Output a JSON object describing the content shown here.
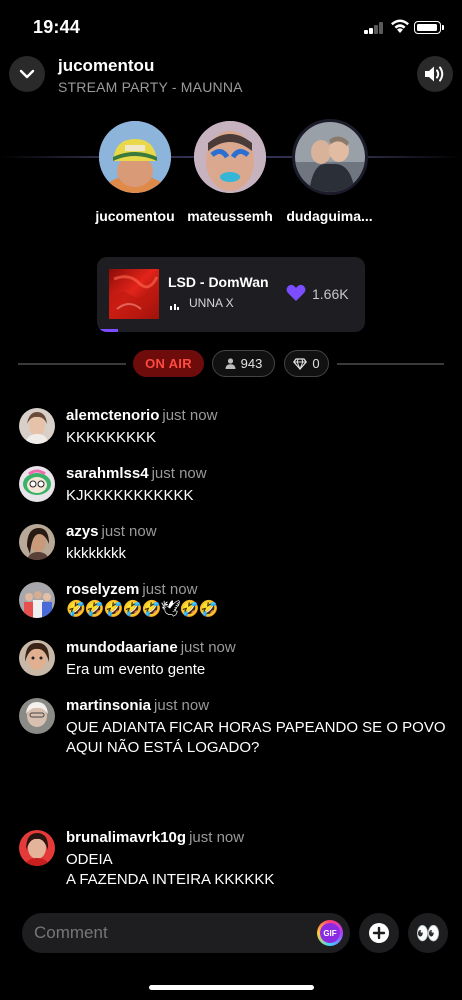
{
  "status_bar": {
    "time": "19:44",
    "signal_bars": 2,
    "battery_level": 0.8
  },
  "header": {
    "title": "jucomentou",
    "subtitle": "STREAM PARTY - MAUNNA",
    "collapse_icon": "chevron-down-icon",
    "volume_icon": "speaker-icon"
  },
  "participants": [
    {
      "name": "jucomentou"
    },
    {
      "name": "mateussemh"
    },
    {
      "name": "dudaguima..."
    }
  ],
  "now_playing": {
    "title": "LSD - DomWan",
    "artist": "UNNA X",
    "likes": "1.66K",
    "progress": 0.08,
    "accent": "#7b4dff"
  },
  "live": {
    "on_air_label": "ON AIR",
    "viewers": "943",
    "gems": "0",
    "on_air_color": "#ff4a40"
  },
  "chat": [
    {
      "user": "alemctenorio",
      "time": "just now",
      "text": "KKKKKKKKK"
    },
    {
      "user": "sarahmlss4",
      "time": "just now",
      "text": "KJKKKKKKKKKKK"
    },
    {
      "user": "azys",
      "time": "just now",
      "text": "kkkkkkkk"
    },
    {
      "user": "roselyzem",
      "time": "just now",
      "text": "🤣🤣🤣🤣🤣🕊🤣🤣"
    },
    {
      "user": "mundodaariane",
      "time": "just now",
      "text": "Era um evento gente"
    },
    {
      "user": "martinsonia",
      "time": "just now",
      "text": "QUE ADIANTA FICAR HORAS PAPEANDO SE O POVO\nAQUI NÃO ESTÁ LOGADO?"
    },
    {
      "user": "brunalimavrk10g",
      "time": "just now",
      "text": "ODEIA\nA FAZENDA INTEIRA KKKKKK"
    }
  ],
  "composer": {
    "placeholder": "Comment",
    "gif_label": "GIF",
    "plus_icon": "plus-icon",
    "eyes_emoji": "👀"
  }
}
